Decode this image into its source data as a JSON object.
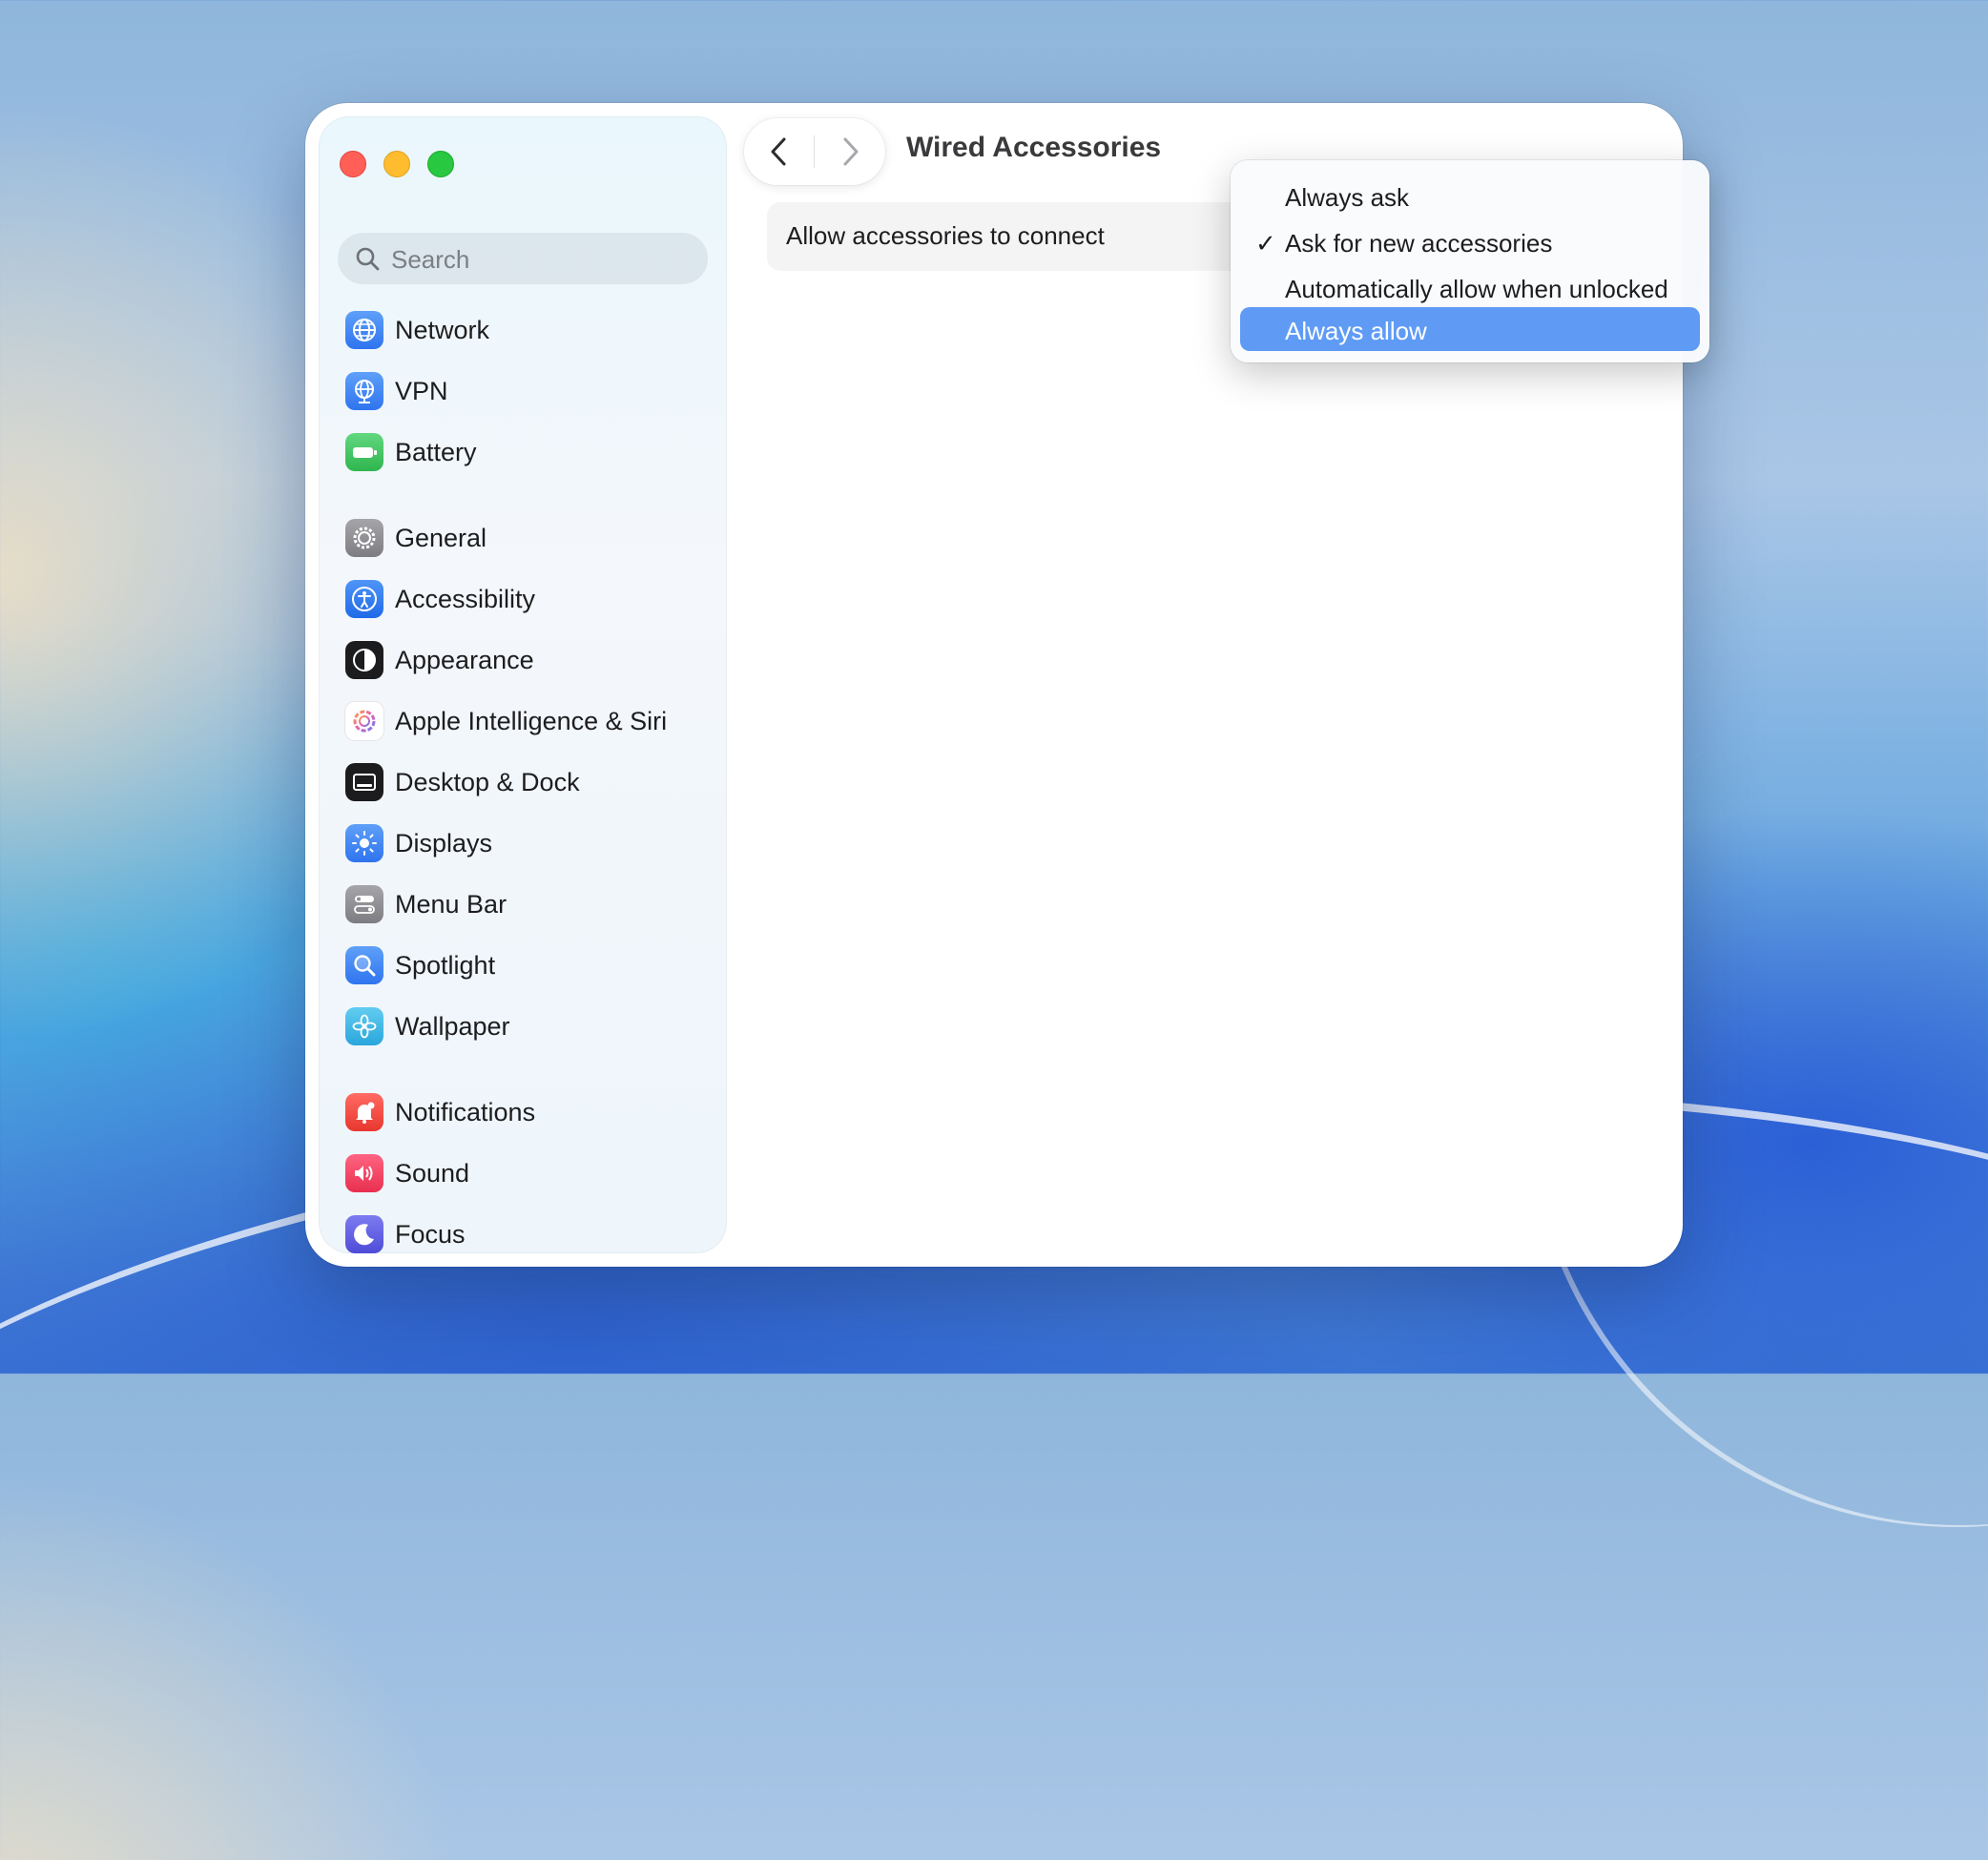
{
  "window": {
    "title": "Wired Accessories"
  },
  "search": {
    "placeholder": "Search"
  },
  "sidebar": {
    "items": [
      {
        "label": "Network",
        "icon": "globe-icon",
        "color": "#3d82f6"
      },
      {
        "label": "VPN",
        "icon": "globe-network-icon",
        "color": "#3d82f6"
      },
      {
        "label": "Battery",
        "icon": "battery-icon",
        "color": "#34c759"
      },
      {
        "label": "General",
        "icon": "gear-icon",
        "color": "#8e8e93"
      },
      {
        "label": "Accessibility",
        "icon": "accessibility-icon",
        "color": "#2f7cf6"
      },
      {
        "label": "Appearance",
        "icon": "appearance-icon",
        "color": "#1c1c1e"
      },
      {
        "label": "Apple Intelligence & Siri",
        "icon": "siri-icon",
        "color": "#f0a3c8"
      },
      {
        "label": "Desktop & Dock",
        "icon": "dock-icon",
        "color": "#1c1c1e"
      },
      {
        "label": "Displays",
        "icon": "sun-icon",
        "color": "#3d82f6"
      },
      {
        "label": "Menu Bar",
        "icon": "menu-bar-icon",
        "color": "#8e8e93"
      },
      {
        "label": "Spotlight",
        "icon": "spotlight-icon",
        "color": "#3d82f6"
      },
      {
        "label": "Wallpaper",
        "icon": "flower-icon",
        "color": "#35b8e6"
      },
      {
        "label": "Notifications",
        "icon": "bell-icon",
        "color": "#ff3b30"
      },
      {
        "label": "Sound",
        "icon": "speaker-icon",
        "color": "#ff375f"
      },
      {
        "label": "Focus",
        "icon": "moon-icon",
        "color": "#5e5ce6"
      }
    ]
  },
  "content": {
    "row_label": "Allow accessories to connect"
  },
  "popup": {
    "options": [
      {
        "label": "Always ask",
        "checked": false,
        "highlighted": false
      },
      {
        "label": "Ask for new accessories",
        "checked": true,
        "highlighted": false
      },
      {
        "label": "Automatically allow when unlocked",
        "checked": false,
        "highlighted": false
      },
      {
        "label": "Always allow",
        "checked": false,
        "highlighted": true
      }
    ],
    "check_glyph": "✓"
  }
}
